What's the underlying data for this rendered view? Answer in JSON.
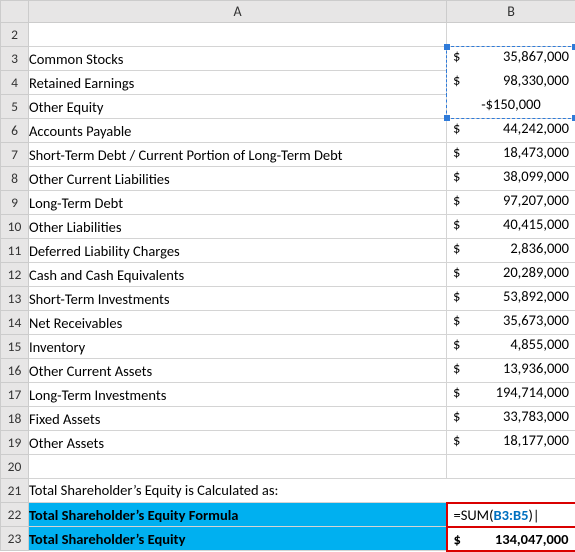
{
  "columns": {
    "A": "A",
    "B": "B"
  },
  "row2": {
    "n": 2
  },
  "rows": [
    {
      "n": 3,
      "label": "Common Stocks",
      "sym": "$",
      "val": "35,867,000",
      "marqTop": true
    },
    {
      "n": 4,
      "label": "Retained Earnings",
      "sym": "$",
      "val": "98,330,000"
    },
    {
      "n": 5,
      "label": "Other Equity",
      "neg": "-$150,000",
      "marqBottom": true
    },
    {
      "n": 6,
      "label": "Accounts Payable",
      "sym": "$",
      "val": "44,242,000"
    },
    {
      "n": 7,
      "label": "Short-Term Debt / Current Portion of Long-Term Debt",
      "sym": "$",
      "val": "18,473,000"
    },
    {
      "n": 8,
      "label": "Other Current Liabilities",
      "sym": "$",
      "val": "38,099,000"
    },
    {
      "n": 9,
      "label": "Long-Term Debt",
      "sym": "$",
      "val": "97,207,000"
    },
    {
      "n": 10,
      "label": "Other Liabilities",
      "sym": "$",
      "val": "40,415,000"
    },
    {
      "n": 11,
      "label": "Deferred Liability Charges",
      "sym": "$",
      "val": "2,836,000"
    },
    {
      "n": 12,
      "label": "Cash and Cash Equivalents",
      "sym": "$",
      "val": "20,289,000"
    },
    {
      "n": 13,
      "label": "Short-Term Investments",
      "sym": "$",
      "val": "53,892,000"
    },
    {
      "n": 14,
      "label": "Net Receivables",
      "sym": "$",
      "val": "35,673,000"
    },
    {
      "n": 15,
      "label": "Inventory",
      "sym": "$",
      "val": "4,855,000"
    },
    {
      "n": 16,
      "label": "Other Current Assets",
      "sym": "$",
      "val": "13,936,000"
    },
    {
      "n": 17,
      "label": "Long-Term Investments",
      "sym": "$",
      "val": "194,714,000"
    },
    {
      "n": 18,
      "label": "Fixed Assets",
      "sym": "$",
      "val": "33,783,000"
    },
    {
      "n": 19,
      "label": "Other Assets",
      "sym": "$",
      "val": "18,177,000"
    }
  ],
  "row20": {
    "n": 20
  },
  "row21": {
    "n": 21,
    "text": "Total Shareholder’s Equity is Calculated as:"
  },
  "row22": {
    "n": 22,
    "label": "Total Shareholder’s Equity Formula",
    "formula_pre": "=SUM(",
    "formula_ref": "B3:B5",
    "formula_post": ")"
  },
  "row23": {
    "n": 23,
    "label": "Total Shareholder’s Equity",
    "sym": "$",
    "val": "134,047,000"
  },
  "caret": "|"
}
